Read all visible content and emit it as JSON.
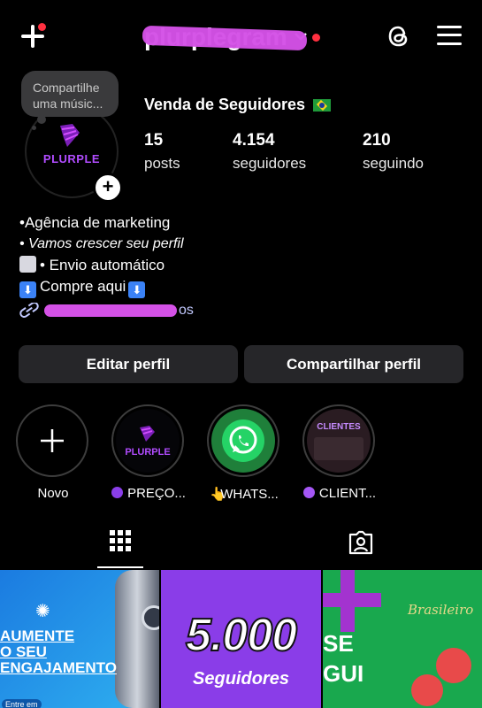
{
  "header": {
    "username": "plurplegram"
  },
  "note": {
    "text": "Compartilhe uma músic..."
  },
  "profile": {
    "avatar_text": "PLURPLE",
    "display_name": "Venda de Seguidores",
    "stats": [
      {
        "value": "15",
        "label": "posts"
      },
      {
        "value": "4.154",
        "label": "seguidores"
      },
      {
        "value": "210",
        "label": "seguindo"
      }
    ]
  },
  "bio": {
    "line1": "•Agência de marketing",
    "line2": "• Vamos crescer seu perfil",
    "line3": "• Envio automático",
    "line4": "Compre aqui",
    "link_suffix": "os"
  },
  "actions": {
    "edit": "Editar perfil",
    "share": "Compartilhar perfil"
  },
  "highlights": [
    {
      "label": "Novo"
    },
    {
      "label": "PREÇO...",
      "cover_text": "PLURPLE"
    },
    {
      "label": "WHATS..."
    },
    {
      "label": "CLIENT...",
      "cover_text": "CLIENTES"
    }
  ],
  "posts": [
    {
      "line1": "AUMENTE",
      "line2": "O SEU",
      "line3": "ENGAJAMENTO",
      "cta": "Entre em"
    },
    {
      "number": "5.000",
      "label": "Seguidores"
    },
    {
      "line1": "SE",
      "line2": "GUI",
      "script": "Brasileiro"
    }
  ],
  "colors": {
    "background": "#000000",
    "button": "#262629",
    "accent_purple": "#b14cff",
    "notification_red": "#ff3040"
  }
}
